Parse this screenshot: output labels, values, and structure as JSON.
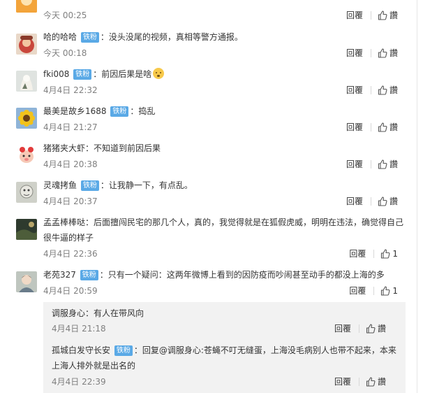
{
  "reply_label": "回覆",
  "like_label": "讚",
  "badge_label": "铁粉",
  "comments": [
    {
      "user": "",
      "text": "",
      "time": "今天 00:25"
    },
    {
      "user": "哈的哈哈",
      "text": "没头没尾的视频，真相等警方通报。",
      "time": "今天 00:18"
    },
    {
      "user": "fki008",
      "text": "前因后果是啥",
      "time": "4月4日 22:32"
    },
    {
      "user": "最美是故乡1688",
      "text": "捣乱",
      "time": "4月4日 21:27"
    },
    {
      "user": "猪猪夹大虾",
      "text": "不知道到前因后果",
      "time": "4月4日 20:38"
    },
    {
      "user": "灵魂拷鱼",
      "text": "让我静一下，有点乱。",
      "time": "4月4日 20:37"
    },
    {
      "user": "孟孟棒棒哒",
      "text": "后面擅闯民宅的那几个人，真的，我觉得就是在狐假虎威，明明在违法，确觉得自己",
      "text2": "很牛逼的样子",
      "time": "4月4日 22:36",
      "likes": "1"
    },
    {
      "user": "老苑327",
      "text": "只有一个疑问：这两年微博上看到的因防疫而吵闹甚至动手的都没上海的多",
      "time": "4月4日 20:59",
      "likes": "1"
    }
  ],
  "replies": [
    {
      "user": "调服身心",
      "text": "有人在带风向",
      "time": "4月4日 21:18"
    },
    {
      "user": "孤城白发守长安",
      "text": "回复@调服身心:苍蝇不叮无缝蛋，上海没毛病别人也带不起来，本来",
      "text2": "上海人排外就是出名的",
      "time": "4月4日 22:39"
    }
  ],
  "icons": {
    "like": "thumbs-up-icon",
    "emoji": "surprised-face-icon"
  }
}
